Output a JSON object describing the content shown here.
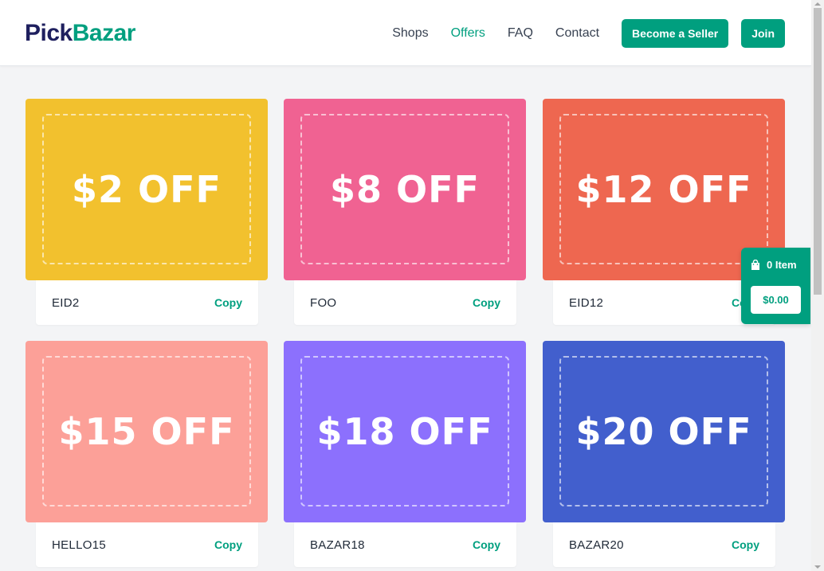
{
  "brand": {
    "part1": "Pick",
    "part2": "Bazar"
  },
  "nav": {
    "items": [
      {
        "label": "Shops",
        "active": false
      },
      {
        "label": "Offers",
        "active": true
      },
      {
        "label": "FAQ",
        "active": false
      },
      {
        "label": "Contact",
        "active": false
      }
    ],
    "seller_label": "Become a Seller",
    "join_label": "Join"
  },
  "colors": {
    "accent": "#009f7f",
    "brand_dark": "#1e1f5e"
  },
  "coupons": [
    {
      "amount": "$2 OFF",
      "code": "EID2",
      "copy_label": "Copy",
      "color": "#f2c12e"
    },
    {
      "amount": "$8 OFF",
      "code": "FOO",
      "copy_label": "Copy",
      "color": "#f06292"
    },
    {
      "amount": "$12 OFF",
      "code": "EID12",
      "copy_label": "Copy",
      "color": "#ee6750"
    },
    {
      "amount": "$15 OFF",
      "code": "HELLO15",
      "copy_label": "Copy",
      "color": "#fca098"
    },
    {
      "amount": "$18 OFF",
      "code": "BAZAR18",
      "copy_label": "Copy",
      "color": "#8c70fd"
    },
    {
      "amount": "$20 OFF",
      "code": "BAZAR20",
      "copy_label": "Copy",
      "color": "#425fcd"
    }
  ],
  "cart": {
    "icon": "shopping-bag-icon",
    "count_label": "0 Item",
    "total": "$0.00"
  }
}
